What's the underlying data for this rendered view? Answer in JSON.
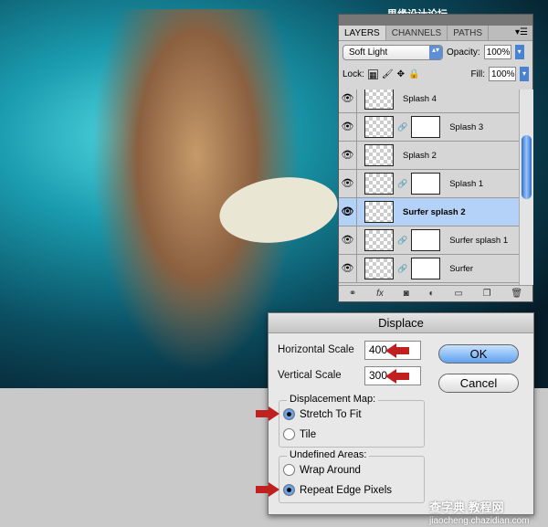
{
  "watermark_top": "思缘设计论坛 WWW.MISSYUAN.COM",
  "watermark_bottom": "查字典 教程网",
  "watermark_url": "jiaocheng.chazidian.com",
  "layers_panel": {
    "tabs": [
      {
        "label": "LAYERS",
        "active": true
      },
      {
        "label": "CHANNELS"
      },
      {
        "label": "PATHS"
      }
    ],
    "blend_mode": "Soft Light",
    "opacity_label": "Opacity:",
    "opacity": "100%",
    "lock_label": "Lock:",
    "fill_label": "Fill:",
    "fill": "100%",
    "layers": [
      {
        "name": "Splash 4",
        "mask": false
      },
      {
        "name": "Splash 3",
        "mask": true
      },
      {
        "name": "Splash 2",
        "mask": false
      },
      {
        "name": "Splash 1",
        "mask": true
      },
      {
        "name": "Surfer splash 2",
        "mask": false,
        "selected": true
      },
      {
        "name": "Surfer splash 1",
        "mask": true
      },
      {
        "name": "Surfer",
        "mask": true
      }
    ]
  },
  "dialog": {
    "title": "Displace",
    "horizontal_label": "Horizontal Scale",
    "horizontal_value": "400",
    "vertical_label": "Vertical Scale",
    "vertical_value": "300",
    "ok": "OK",
    "cancel": "Cancel",
    "map_group": "Displacement Map:",
    "map_options": [
      {
        "label": "Stretch To Fit",
        "checked": true
      },
      {
        "label": "Tile",
        "checked": false
      }
    ],
    "undefined_group": "Undefined Areas:",
    "undefined_options": [
      {
        "label": "Wrap Around",
        "checked": false
      },
      {
        "label": "Repeat Edge Pixels",
        "checked": true
      }
    ]
  },
  "colors": {
    "annotation_arrow": "#c0211f",
    "selected_layer": "#b4d2f8"
  }
}
